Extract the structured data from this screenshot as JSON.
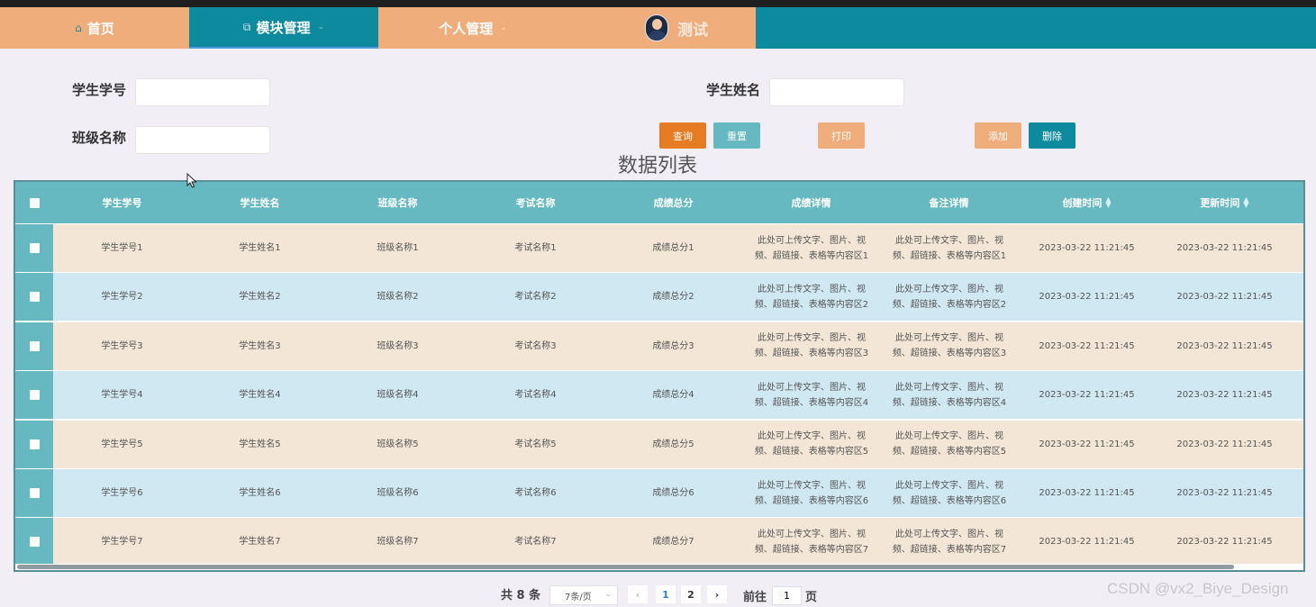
{
  "nav": {
    "home": "首页",
    "module": "模块管理",
    "personal": "个人管理",
    "user": "测试"
  },
  "filters": {
    "student_no_label": "学生学号",
    "student_name_label": "学生姓名",
    "class_label": "班级名称"
  },
  "buttons": {
    "query": "查询",
    "reset": "重置",
    "print": "打印",
    "add": "添加",
    "delete": "删除"
  },
  "colors": {
    "nav_teal": "#0e8a9e",
    "nav_peach": "#f0ad7c",
    "query_btn": "#e57c24",
    "reset_btn": "#66b9c1",
    "print_btn": "#f0ad7c",
    "add_btn": "#f0ad7c",
    "delete_btn": "#0e8a9e",
    "header_bg": "#66b9c1",
    "row_odd": "#f3e6d6",
    "row_even": "#d0e8f2"
  },
  "table": {
    "title": "数据列表",
    "columns": [
      "学生学号",
      "学生姓名",
      "班级名称",
      "考试名称",
      "成绩总分",
      "成绩详情",
      "备注详情",
      "创建时间",
      "更新时间"
    ],
    "rows": [
      [
        "学生学号1",
        "学生姓名1",
        "班级名称1",
        "考试名称1",
        "成绩总分1",
        "此处可上传文字、图片、视频、超链接、表格等内容区1",
        "此处可上传文字、图片、视频、超链接、表格等内容区1",
        "2023-03-22 11:21:45",
        "2023-03-22 11:21:45"
      ],
      [
        "学生学号2",
        "学生姓名2",
        "班级名称2",
        "考试名称2",
        "成绩总分2",
        "此处可上传文字、图片、视频、超链接、表格等内容区2",
        "此处可上传文字、图片、视频、超链接、表格等内容区2",
        "2023-03-22 11:21:45",
        "2023-03-22 11:21:45"
      ],
      [
        "学生学号3",
        "学生姓名3",
        "班级名称3",
        "考试名称3",
        "成绩总分3",
        "此处可上传文字、图片、视频、超链接、表格等内容区3",
        "此处可上传文字、图片、视频、超链接、表格等内容区3",
        "2023-03-22 11:21:45",
        "2023-03-22 11:21:45"
      ],
      [
        "学生学号4",
        "学生姓名4",
        "班级名称4",
        "考试名称4",
        "成绩总分4",
        "此处可上传文字、图片、视频、超链接、表格等内容区4",
        "此处可上传文字、图片、视频、超链接、表格等内容区4",
        "2023-03-22 11:21:45",
        "2023-03-22 11:21:45"
      ],
      [
        "学生学号5",
        "学生姓名5",
        "班级名称5",
        "考试名称5",
        "成绩总分5",
        "此处可上传文字、图片、视频、超链接、表格等内容区5",
        "此处可上传文字、图片、视频、超链接、表格等内容区5",
        "2023-03-22 11:21:45",
        "2023-03-22 11:21:45"
      ],
      [
        "学生学号6",
        "学生姓名6",
        "班级名称6",
        "考试名称6",
        "成绩总分6",
        "此处可上传文字、图片、视频、超链接、表格等内容区6",
        "此处可上传文字、图片、视频、超链接、表格等内容区6",
        "2023-03-22 11:21:45",
        "2023-03-22 11:21:45"
      ],
      [
        "学生学号7",
        "学生姓名7",
        "班级名称7",
        "考试名称7",
        "成绩总分7",
        "此处可上传文字、图片、视频、超链接、表格等内容区7",
        "此处可上传文字、图片、视频、超链接、表格等内容区7",
        "2023-03-22 11:21:45",
        "2023-03-22 11:21:45"
      ]
    ]
  },
  "pagination": {
    "total": "共 8 条",
    "page_size": "7条/页",
    "prev": "‹",
    "page1": "1",
    "page2": "2",
    "next": "›",
    "goto_label": "前往",
    "goto_value": "1",
    "goto_unit": "页"
  },
  "watermark": "CSDN @vx2_Biye_Design"
}
